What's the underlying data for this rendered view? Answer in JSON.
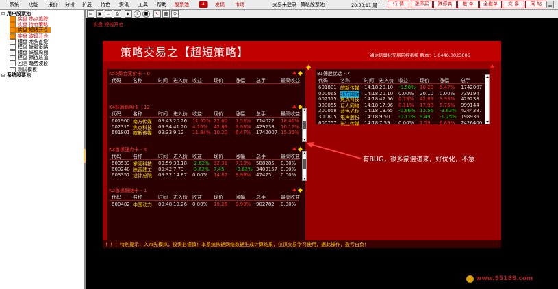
{
  "menu": [
    "系统",
    "功能",
    "报价",
    "分析",
    "扩展",
    "特色",
    "资讯",
    "工具",
    "帮助"
  ],
  "topbar": {
    "pool_label": "股票池",
    "pool_count": "4",
    "discover": "发现",
    "market": "市场",
    "status": "交易未登录",
    "strategy_pool": "策略股票池",
    "time": "20:33:11 周一",
    "buttons": [
      "行 情",
      "涨停买",
      "跌停卖",
      "散 单",
      "全撤单",
      "交 易",
      "网 站"
    ],
    "win_buttons": [
      "▁",
      "▢",
      "✕"
    ]
  },
  "sidebar": {
    "items": [
      {
        "label": "用户股票池",
        "type": "root",
        "expanded": true
      },
      {
        "label": "实盘 热点追踪",
        "type": "child",
        "color": "#e00000"
      },
      {
        "label": "实盘 持仓策略",
        "type": "child",
        "color": "#e00000"
      },
      {
        "label": "实盘 短线开仓",
        "type": "child",
        "color": "#e00000",
        "selected": true
      },
      {
        "label": "实盘 波段开仓",
        "type": "child",
        "color": "#e00000"
      },
      {
        "label": "模盘 龙头首级",
        "type": "child",
        "color": "#000000"
      },
      {
        "label": "模盘 妖股策略",
        "type": "child",
        "color": "#000000"
      },
      {
        "label": "模盘 妖股周期",
        "type": "child",
        "color": "#000000"
      },
      {
        "label": "模盘 预选股池",
        "type": "child",
        "color": "#000000"
      },
      {
        "label": "回测 趋势波段",
        "type": "child",
        "color": "#000000"
      },
      {
        "label": "测试模板",
        "type": "child",
        "color": "#000000"
      },
      {
        "label": "系统股票池",
        "type": "root",
        "expanded": false
      }
    ]
  },
  "breadcrumb": "实盘 短线开仓",
  "panel": {
    "title": "策略交易之【超短策略】",
    "subtitle": "通达信量化交易内控系统  版本：1.0446.3023006"
  },
  "left_sections": [
    {
      "title": "K55集合竞价卡 - 0",
      "columns": [
        "代码",
        "名称",
        "时间",
        "进入价",
        "收益",
        "现价",
        "涨幅",
        "总手",
        "最高收益"
      ],
      "rows": []
    },
    {
      "title": "K4妖股低吸卡 - 12",
      "columns": [
        "代码",
        "名称",
        "时间",
        "进入价",
        "收益",
        "现价",
        "涨幅",
        "总手",
        "最高收益"
      ],
      "rows": [
        [
          "601900",
          "南方传媒",
          "09:43",
          "20.26",
          "11.55%",
          "22.60",
          "1.53%",
          "714022",
          "18.46%"
        ],
        [
          "002315",
          "焦点科技",
          "09:34",
          "41.20",
          "4.10%",
          "42.89",
          "3.93%",
          "429238",
          "10.17%"
        ],
        [
          "601801",
          "皖新传媒",
          "09:33",
          "9.12",
          "11.84%",
          "10.20",
          "6.47%",
          "1742007",
          "15.35%"
        ]
      ]
    },
    {
      "title": "K3首板强点卡 - 4",
      "columns": [
        "代码",
        "名称",
        "时间",
        "进入价",
        "收益",
        "现价",
        "涨幅",
        "总手",
        "最高收益"
      ],
      "rows": [
        [
          "603533",
          "掌阅科技",
          "09:59",
          "33.18",
          "-2.62%",
          "32.31",
          "7.13%",
          "588285",
          "0.00%"
        ],
        [
          "600248",
          "陕西建工",
          "09:42",
          "7.73",
          "-3.62%",
          "7.45",
          "-3.62%",
          "3403157",
          "0.00%"
        ],
        [
          "603357",
          "设计总院",
          "09:32",
          "14.87",
          "0.00%",
          "14.87",
          "9.99%",
          "47475",
          "0.00%"
        ]
      ]
    },
    {
      "title": "K2首板跟随卡 - 1",
      "columns": [
        "代码",
        "名称",
        "时间",
        "进入价",
        "收益",
        "现价",
        "涨幅",
        "总手",
        "最高收益"
      ],
      "rows": [
        [
          "600482",
          "中国动力",
          "09:48",
          "19.26",
          "0.00%",
          "19.26",
          "9.99%",
          "902782",
          "0.00%"
        ]
      ]
    }
  ],
  "right_section": {
    "title": "81筛股优选 - 7",
    "columns": [
      "代码",
      "名称",
      "时间",
      "进入价",
      "收益",
      "现价",
      "涨幅",
      "总手"
    ],
    "rows": [
      [
        "601801",
        "皖新传媒",
        "14:18",
        "20.10",
        "-0.58%",
        "10.20",
        "6.47%",
        "1742007"
      ],
      [
        "000065",
        "北方国际",
        "14:18",
        "20.10",
        "0.00%",
        "20.10",
        "0.00%",
        "739194"
      ],
      [
        "002315",
        "焦点科技",
        "14:18",
        "42.56",
        "0.78%",
        "42.89",
        "3.93%",
        "429238"
      ],
      [
        "300055",
        "巨人网络",
        "14:18",
        "17.96",
        "0.11%",
        "17.98",
        "5.76%",
        "999144"
      ],
      [
        "300058",
        "蓝色光标",
        "14:18",
        "13.65",
        "-0.66%",
        "13.56",
        "-3.63%",
        "4244387"
      ],
      [
        "300805",
        "电声股份",
        "14:18",
        "9.50",
        "-0.11%",
        "9.49",
        "-1.25%",
        "198936"
      ],
      [
        "600757",
        "长江传媒",
        "14:18",
        "7.59",
        "0.00%",
        "7.59",
        "6.69%",
        "2426400"
      ]
    ]
  },
  "annotation": "有BUG，很多蒙混进来，好优化，不急",
  "ticker": "！！！特别提示：入市先模拟，投资必谨慎！本系统依据网络数据生成计算结果，仅供交易学习使用，据此操作，盈亏自负！",
  "watermark": "www.55188.com",
  "colors": {
    "accent": "#c10000",
    "panel": "#9b0000",
    "up": "#ff3030",
    "down": "#00e000",
    "name": "#ffe000",
    "sel": "#f28a00"
  }
}
